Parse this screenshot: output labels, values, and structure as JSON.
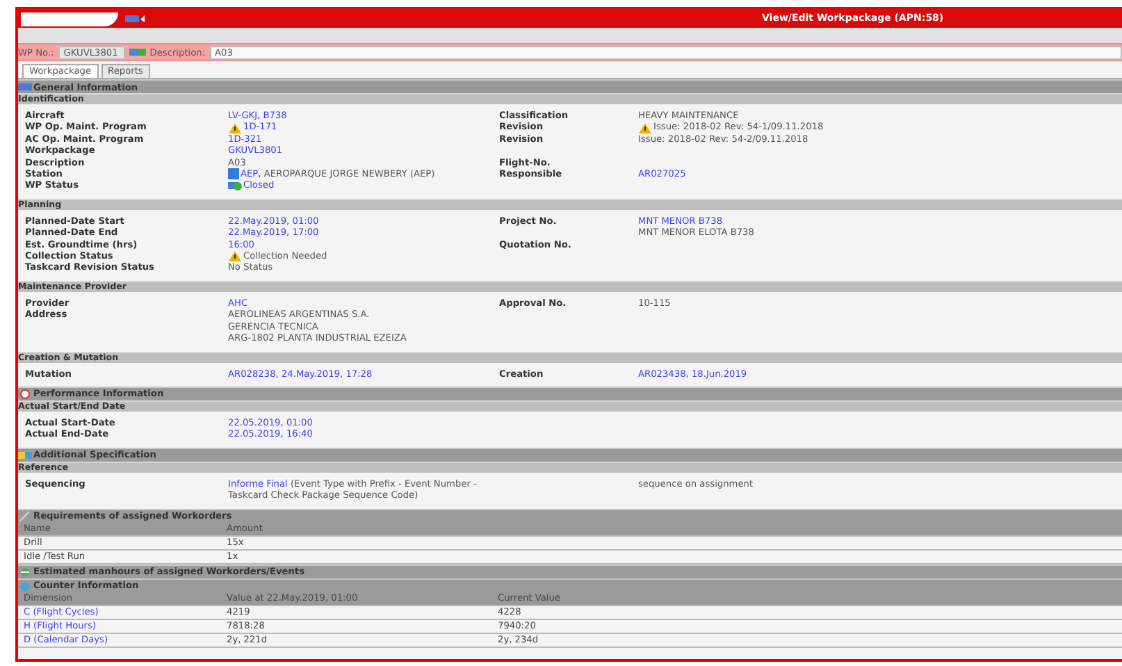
{
  "window": {
    "title": "View/Edit Workpackage (APN:58)"
  },
  "toolbar": {
    "wp_no_label": "WP No.:",
    "wp_no": "GKUVL3801",
    "description_label": "Description:",
    "description": "A03"
  },
  "tabs": [
    {
      "label": "Workpackage",
      "selected": true
    },
    {
      "label": "Reports",
      "selected": false
    }
  ],
  "sections": [
    {
      "kind": "header",
      "title": "General Information"
    },
    {
      "kind": "subheader",
      "title": "Identification"
    },
    {
      "kind": "fields",
      "rows": [
        {
          "left": {
            "label": "Aircraft",
            "lines": [
              {
                "text": "LV-GKJ, B738",
                "link": true
              }
            ]
          },
          "right": {
            "label": "Classification",
            "lines": [
              {
                "text": "HEAVY MAINTENANCE",
                "link": false
              }
            ]
          }
        },
        {
          "left": {
            "label": "WP Op. Maint. Program",
            "lines": [
              {
                "text": "1D-171",
                "link": true,
                "warning": true
              }
            ]
          },
          "right": {
            "label": "Revision",
            "lines": [
              {
                "text": "Issue: 2018-02 Rev: 54-1/09.11.2018",
                "link": false,
                "warning": true
              }
            ]
          }
        },
        {
          "left": {
            "label": "AC Op. Maint. Program",
            "lines": [
              {
                "text": "1D-321",
                "link": true
              }
            ]
          },
          "right": {
            "label": "Revision",
            "lines": [
              {
                "text": "Issue: 2018-02 Rev: 54-2/09.11.2018",
                "link": false
              }
            ]
          }
        },
        {
          "left": {
            "label": "Workpackage",
            "lines": [
              {
                "text": "GKUVL3801",
                "link": true
              }
            ]
          }
        },
        {
          "left": {
            "label": "Description",
            "lines": [
              {
                "text": "A03",
                "link": false
              }
            ]
          },
          "right": {
            "label": "Flight-No."
          }
        },
        {
          "left": {
            "label": "Station",
            "lines": [
              {
                "text": "AEP",
                "link": true,
                "kind": "station",
                "rest": ", AEROPARQUE JORGE NEWBERY (AEP)"
              }
            ]
          },
          "right": {
            "label": "Responsible",
            "lines": [
              {
                "text": "AR027025",
                "link": true
              }
            ]
          }
        },
        {
          "left": {
            "label": "WP Status",
            "lines": [
              {
                "text": "Closed",
                "link": true,
                "kind": "status"
              }
            ]
          }
        }
      ]
    },
    {
      "kind": "subheader",
      "title": "Planning"
    },
    {
      "kind": "fields",
      "rows": [
        {
          "left": {
            "label": "Planned-Date Start",
            "lines": [
              {
                "text": "22.May.2019, 01:00",
                "link": true
              }
            ]
          },
          "right": {
            "label": "Project No.",
            "lines": [
              {
                "text": "MNT MENOR B738",
                "link": true
              }
            ]
          }
        },
        {
          "left": {
            "label": "Planned-Date End",
            "lines": [
              {
                "text": "22.May.2019, 17:00",
                "link": true
              }
            ]
          },
          "right": {
            "lines": [
              {
                "text": "MNT MENOR ELOTA B738",
                "link": false
              }
            ]
          }
        },
        {
          "left": {
            "label": "Est. Groundtime (hrs)",
            "lines": [
              {
                "text": "16:00",
                "link": true
              }
            ]
          },
          "right": {
            "label": "Quotation No."
          }
        },
        {
          "left": {
            "label": "Collection Status",
            "lines": [
              {
                "text": "Collection Needed",
                "link": false,
                "warning": true
              }
            ]
          }
        },
        {
          "left": {
            "label": "Taskcard Revision Status",
            "lines": [
              {
                "text": "No Status",
                "link": false
              }
            ]
          }
        }
      ]
    },
    {
      "kind": "subheader",
      "title": "Maintenance Provider"
    },
    {
      "kind": "fields",
      "rows": [
        {
          "left": {
            "label": "Provider",
            "lines": [
              {
                "text": "AHC",
                "link": true
              }
            ]
          },
          "right": {
            "label": "Approval No.",
            "lines": [
              {
                "text": "10-115",
                "link": false
              }
            ]
          }
        },
        {
          "left": {
            "label": "Address",
            "lines": [
              {
                "text": "AEROLINEAS ARGENTINAS S.A.",
                "link": false
              },
              {
                "text": "GERENCIA TECNICA",
                "link": false
              },
              {
                "text": "ARG-1802 PLANTA INDUSTRIAL EZEIZA",
                "link": false
              }
            ]
          }
        }
      ]
    },
    {
      "kind": "subheader",
      "title": "Creation & Mutation"
    },
    {
      "kind": "fields",
      "rows": [
        {
          "left": {
            "label": "Mutation",
            "lines": [
              {
                "text": "AR028238, 24.May.2019, 17:28",
                "link": true
              }
            ]
          },
          "right": {
            "label": "Creation",
            "lines": [
              {
                "text": "AR023438, 18.Jun.2019",
                "link": true
              }
            ]
          }
        }
      ]
    },
    {
      "kind": "header",
      "title": "Performance Information"
    },
    {
      "kind": "subheader",
      "title": "Actual Start/End Date"
    },
    {
      "kind": "fields",
      "rows": [
        {
          "left": {
            "label": "Actual Start-Date",
            "lines": [
              {
                "text": "22.05.2019, 01:00",
                "link": true
              }
            ]
          }
        },
        {
          "left": {
            "label": "Actual End-Date",
            "lines": [
              {
                "text": "22.05.2019, 16:40",
                "link": true
              }
            ]
          }
        }
      ]
    },
    {
      "kind": "header",
      "title": "Additional Specification"
    },
    {
      "kind": "subheader",
      "title": "Reference"
    },
    {
      "kind": "fields",
      "rows": [
        {
          "left": {
            "label": "Sequencing",
            "lines": [
              {
                "text": "Informe Final",
                "link": true,
                "rest": " (Event Type with Prefix - Event Number - Taskcard Check Package Sequence Code)"
              }
            ]
          },
          "right": {
            "lines": [
              {
                "text": "sequence on assignment",
                "link": false
              }
            ]
          }
        }
      ]
    },
    {
      "kind": "header",
      "title": "Requirements of assigned Workorders"
    },
    {
      "kind": "table",
      "columns": [
        "Name",
        "Amount"
      ],
      "rows": [
        {
          "cells": [
            {
              "text": "Drill",
              "link": false
            },
            {
              "text": "15x",
              "link": false
            }
          ]
        },
        {
          "cells": [
            {
              "text": "Idle /Test Run",
              "link": false
            },
            {
              "text": "1x",
              "link": false
            }
          ]
        }
      ]
    },
    {
      "kind": "header",
      "title": "Estimated manhours of assigned Workorders/Events"
    },
    {
      "kind": "header",
      "title": "Counter Information"
    },
    {
      "kind": "table",
      "columns": [
        "Dimension",
        "Value at 22.May.2019, 01:00",
        "Current Value"
      ],
      "rows": [
        {
          "cells": [
            {
              "text": "C (Flight Cycles)",
              "link": true
            },
            {
              "text": "4219",
              "link": false
            },
            {
              "text": "4228",
              "link": false
            }
          ]
        },
        {
          "cells": [
            {
              "text": "H (Flight Hours)",
              "link": true
            },
            {
              "text": "7818:28",
              "link": false
            },
            {
              "text": "7940:20",
              "link": false
            }
          ]
        },
        {
          "cells": [
            {
              "text": "D (Calendar Days)",
              "link": true
            },
            {
              "text": "2y, 221d",
              "link": false
            },
            {
              "text": "2y, 234d",
              "link": false
            }
          ]
        }
      ]
    }
  ]
}
